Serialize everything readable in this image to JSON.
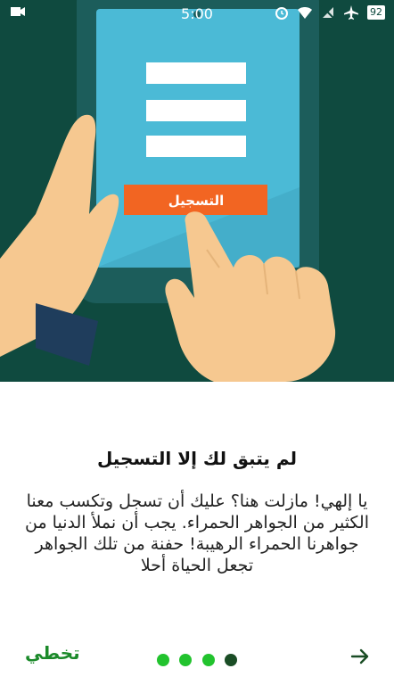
{
  "status_bar": {
    "time": "5:00",
    "battery_level": "92",
    "icons": [
      "notification-icon",
      "alarm-icon",
      "wifi-icon",
      "no-sim-icon",
      "airplane-icon",
      "battery-icon"
    ]
  },
  "illustration": {
    "register_button_label": "التسجيل",
    "colors": {
      "background": "#0f4a3f",
      "tablet_frame": "#1c5d5b",
      "screen": "#4bbad6",
      "button": "#f26522",
      "skin": "#f6c890",
      "sleeve": "#1f3d5c"
    }
  },
  "onboarding": {
    "title": "لم يتبق لك إلا التسجيل",
    "description": "يا إلهي! مازلت هنا؟ عليك أن تسجل وتكسب معنا الكثير من الجواهر الحمراء. يجب أن نملأ الدنيا من جواهرنا الحمراء الرهيبة! حفنة من تلك الجواهر تجعل الحياة أحلا"
  },
  "footer": {
    "skip_label": "تخطي",
    "page_count": 4,
    "current_page": 4,
    "colors": {
      "dot_inactive": "#22c32e",
      "dot_active": "#1a4d25",
      "accent": "#1b8a2a"
    }
  }
}
